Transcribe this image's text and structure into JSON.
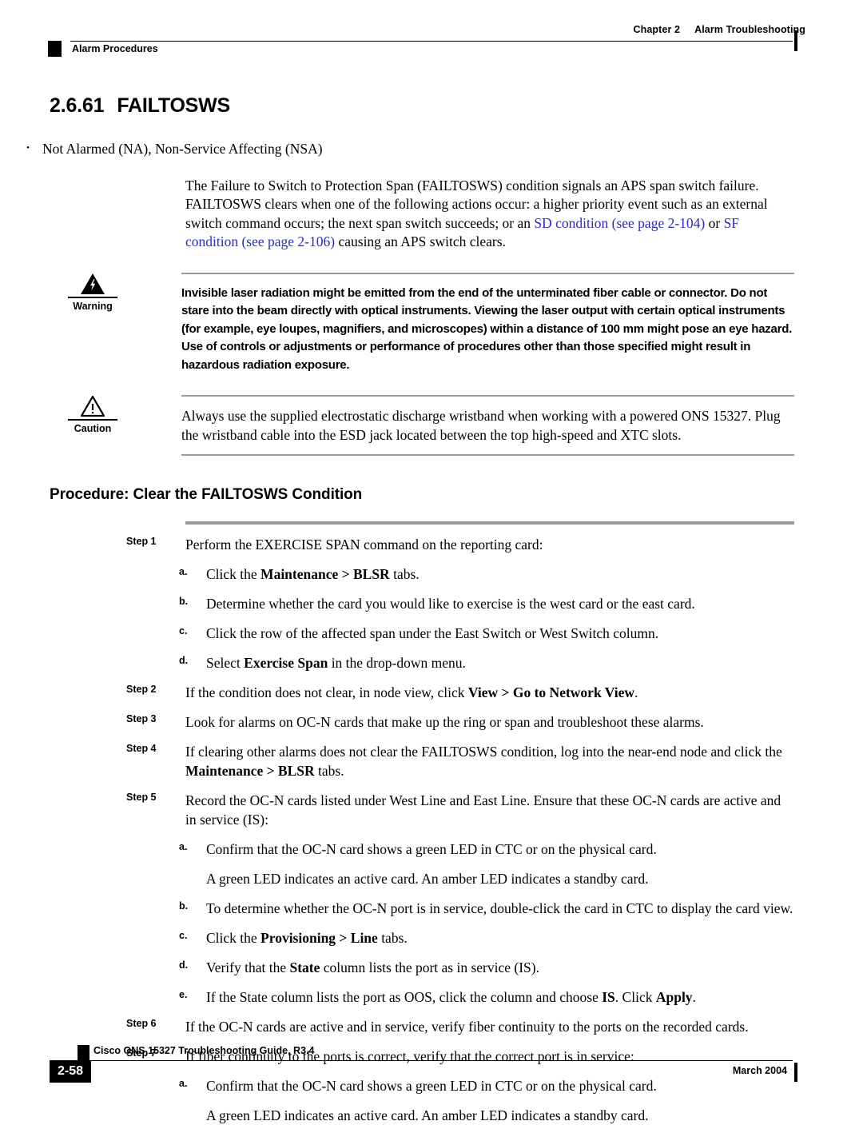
{
  "header": {
    "chapter": "Chapter 2",
    "chapter_title": "Alarm Troubleshooting",
    "section": "Alarm Procedures"
  },
  "section": {
    "number": "2.6.61",
    "title": "FAILTOSWS"
  },
  "bullets": [
    "Not Alarmed (NA), Non-Service Affecting (NSA)"
  ],
  "intro": {
    "part1": "The Failure to Switch to Protection Span (FAILTOSWS) condition signals an APS span switch failure. FAILTOSWS clears when one of the following actions occur: a higher priority event such as an external switch command occurs; the next span switch succeeds; or an ",
    "link1": "SD condition (see page 2-104)",
    "mid": " or ",
    "link2": "SF condition (see page 2-106)",
    "part2": " causing an APS switch clears."
  },
  "warning": {
    "label": "Warning",
    "icon": "warning-triangle-lightning-icon",
    "text": "Invisible laser radiation might be emitted from the end of the unterminated fiber cable or connector. Do not stare into the beam directly with optical instruments. Viewing the laser output with certain optical instruments (for example, eye loupes, magnifiers, and microscopes) within a distance of 100 mm might pose an eye hazard. Use of controls or adjustments or performance of procedures other than those specified might result in hazardous radiation exposure."
  },
  "caution": {
    "label": "Caution",
    "icon": "caution-triangle-exclamation-icon",
    "text": "Always use the supplied electrostatic discharge wristband when working with a powered ONS 15327. Plug the wristband cable into the ESD jack located between the top high-speed and XTC slots."
  },
  "procedure": {
    "title": "Procedure: Clear the FAILTOSWS Condition",
    "steps": [
      {
        "label": "Step 1",
        "text": "Perform the EXERCISE SPAN command on the reporting card:",
        "substeps": [
          {
            "label": "a.",
            "html": "Click the <b>Maintenance &gt; BLSR</b> tabs."
          },
          {
            "label": "b.",
            "html": "Determine whether the card you would like to exercise is the west card or the east card."
          },
          {
            "label": "c.",
            "html": "Click the row of the affected span under the East Switch or West Switch column."
          },
          {
            "label": "d.",
            "html": "Select <b>Exercise Span</b> in the drop-down menu."
          }
        ]
      },
      {
        "label": "Step 2",
        "html": "If the condition does not clear, in node view, click <b>View &gt; Go to Network View</b>.",
        "substeps": []
      },
      {
        "label": "Step 3",
        "html": "Look for alarms on OC-N cards that make up the ring or span and troubleshoot these alarms.",
        "substeps": []
      },
      {
        "label": "Step 4",
        "html": "If clearing other alarms does not clear the FAILTOSWS condition, log into the near-end node and click the <b>Maintenance &gt; BLSR</b> tabs.",
        "substeps": []
      },
      {
        "label": "Step 5",
        "html": "Record the OC-N cards listed under West Line and East Line. Ensure that these OC-N cards are active and in service (IS):",
        "substeps": [
          {
            "label": "a.",
            "html": "Confirm that the OC-N card shows a green LED in CTC or on the physical card."
          },
          {
            "label": "",
            "html": "A green LED indicates an active card. An amber LED indicates a standby card."
          },
          {
            "label": "b.",
            "html": "To determine whether the OC-N port is in service, double-click the card in CTC to display the card view."
          },
          {
            "label": "c.",
            "html": "Click the <b>Provisioning &gt; Line</b> tabs."
          },
          {
            "label": "d.",
            "html": "Verify that the <b>State</b> column lists the port as in service (IS)."
          },
          {
            "label": "e.",
            "html": "If the State column lists the port as OOS, click the column and choose <b>IS</b>. Click <b>Apply</b>."
          }
        ]
      },
      {
        "label": "Step 6",
        "html": "If the OC-N cards are active and in service, verify fiber continuity to the ports on the recorded cards.",
        "substeps": []
      },
      {
        "label": "Step 7",
        "html": "If fiber continuity to the ports is correct, verify that the correct port is in service:",
        "substeps": [
          {
            "label": "a.",
            "html": "Confirm that the OC-N card shows a green LED in CTC or on the physical card."
          },
          {
            "label": "",
            "html": "A green LED indicates an active card. An amber LED indicates a standby card."
          }
        ]
      }
    ]
  },
  "footer": {
    "page_number": "2-58",
    "guide": "Cisco ONS 15327 Troubleshooting Guide, R3.4",
    "date": "March 2004"
  },
  "colors": {
    "link": "#2b2bc8",
    "rule_gray": "#9b9b9b",
    "text": "#000000"
  }
}
